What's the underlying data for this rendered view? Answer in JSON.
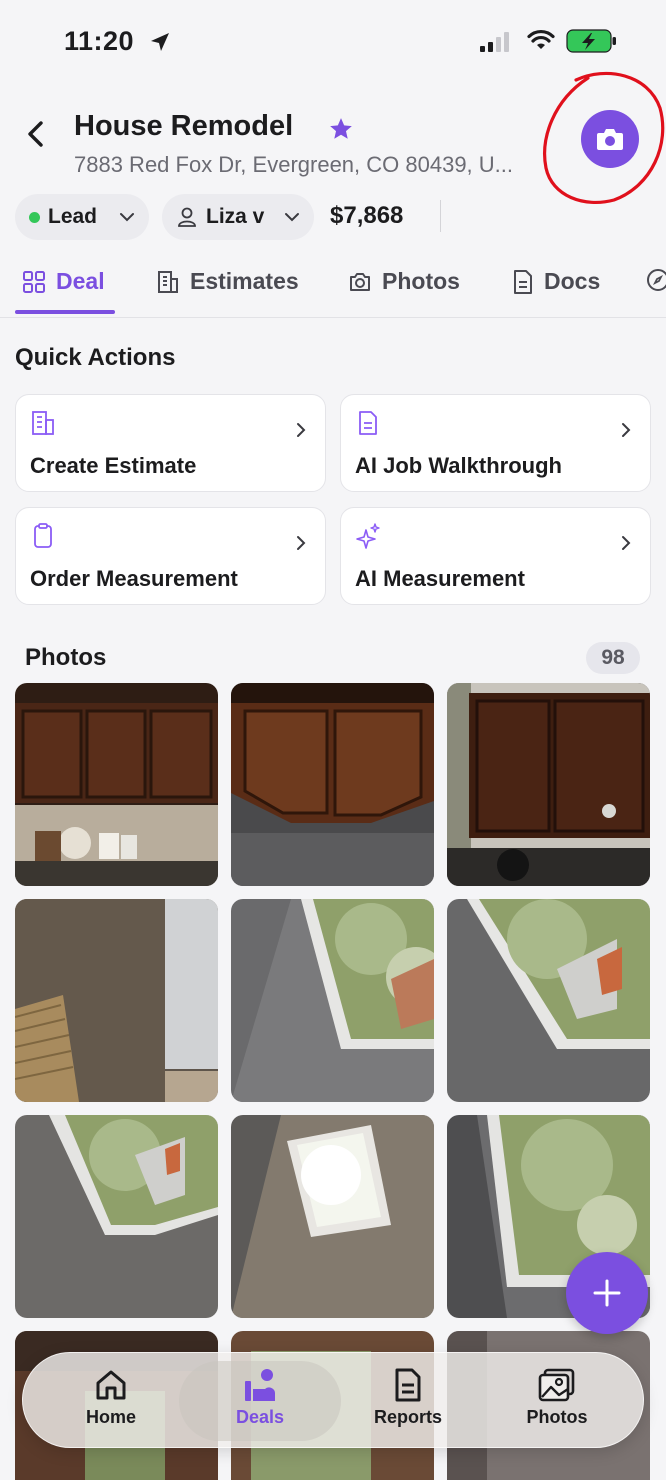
{
  "status_bar": {
    "time": "11:20",
    "icons": [
      "location-arrow-icon",
      "cellular-signal-icon",
      "wifi-icon",
      "battery-charging-icon"
    ]
  },
  "header": {
    "title": "House Remodel",
    "address": "7883 Red Fox Dr, Evergreen, CO 80439, U...",
    "back_icon": "chevron-left-icon",
    "favorite_icon": "star-icon",
    "camera_icon": "camera-icon"
  },
  "chips": {
    "status_label": "Lead",
    "assignee_label": "Liza v",
    "price": "$7,868"
  },
  "tabs": [
    {
      "label": "Deal",
      "icon": "grid-icon",
      "active": true
    },
    {
      "label": "Estimates",
      "icon": "building-icon",
      "active": false
    },
    {
      "label": "Photos",
      "icon": "camera-icon",
      "active": false
    },
    {
      "label": "Docs",
      "icon": "document-icon",
      "active": false
    },
    {
      "label": "",
      "icon": "compass-icon",
      "active": false
    }
  ],
  "quick_actions": {
    "title": "Quick Actions",
    "items": [
      {
        "label": "Create Estimate",
        "icon": "building-icon"
      },
      {
        "label": "AI Job Walkthrough",
        "icon": "document-icon"
      },
      {
        "label": "Order Measurement",
        "icon": "clipboard-icon"
      },
      {
        "label": "AI Measurement",
        "icon": "sparkles-icon"
      }
    ]
  },
  "photos": {
    "title": "Photos",
    "count": "98"
  },
  "bottom_nav": [
    {
      "label": "Home",
      "icon": "home-icon",
      "active": false
    },
    {
      "label": "Deals",
      "icon": "deals-icon",
      "active": true
    },
    {
      "label": "Reports",
      "icon": "report-icon",
      "active": false
    },
    {
      "label": "Photos",
      "icon": "gallery-icon",
      "active": false
    }
  ],
  "colors": {
    "accent": "#7b4fe0",
    "status_green": "#34c759",
    "annotation_red": "#e0101c"
  }
}
